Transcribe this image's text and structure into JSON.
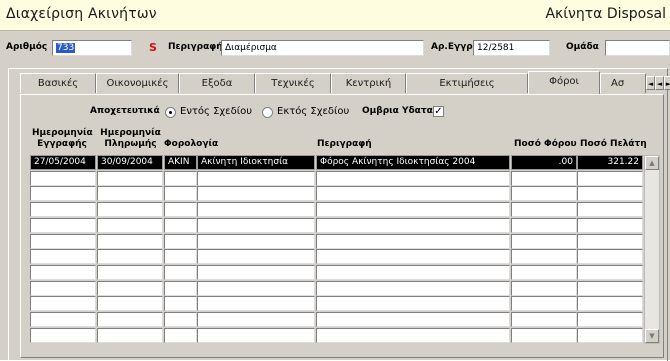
{
  "window": {
    "title": "Διαχείριση Ακινήτων",
    "right_title": "Ακίνητα Disposal"
  },
  "header": {
    "number_label": "Αριθμός",
    "number_value": "733",
    "s_button": "S",
    "description_label": "Περιγραφή",
    "description_value": "Διαμέρισμα",
    "registry_label": "Αρ.Εγγρ",
    "registry_value": "12/2581",
    "group_label": "Ομάδα",
    "group_value": ""
  },
  "tabs": [
    {
      "label": "Βασικές"
    },
    {
      "label": "Οικονομικές"
    },
    {
      "label": "Εξοδα"
    },
    {
      "label": "Τεχνικές"
    },
    {
      "label": "Κεντρική"
    },
    {
      "label": "Εκτιμήσεις"
    },
    {
      "label": "Φόροι",
      "active": true
    },
    {
      "label": "Ασ"
    }
  ],
  "tab_arrows": [
    "◄",
    "◄",
    "►",
    "►"
  ],
  "options": {
    "drainage_label": "Αποχετευτικά",
    "within_plan": "Εντός Σχεδίου",
    "outside_plan": "Εκτός Σχεδίου",
    "selected": "within_plan",
    "rainwater_label": "Ομβρια Υδατα",
    "rainwater_checked": true,
    "check_glyph": "✓"
  },
  "table": {
    "columns": [
      {
        "line1": "Ημερομηνία",
        "line2": "Εγγραφής"
      },
      {
        "line1": "Ημερομηνία",
        "line2": "Πληρωμής"
      },
      {
        "line1": "",
        "line2": "Φορολογία"
      },
      {
        "line1": "",
        "line2": ""
      },
      {
        "line1": "",
        "line2": "Περιγραφή"
      },
      {
        "line1": "",
        "line2": "Ποσό Φόρου"
      },
      {
        "line1": "",
        "line2": "Ποσό Πελάτη"
      }
    ],
    "rows": [
      [
        "27/05/2004",
        "30/09/2004",
        "AKIN",
        "Ακίνητη Ιδιοκτησία",
        "Φόρος Ακίνητης Ιδιοκτησίας 2004",
        ".00",
        "321.22"
      ],
      [
        "",
        "",
        "",
        "",
        "",
        "",
        ""
      ],
      [
        "",
        "",
        "",
        "",
        "",
        "",
        ""
      ],
      [
        "",
        "",
        "",
        "",
        "",
        "",
        ""
      ],
      [
        "",
        "",
        "",
        "",
        "",
        "",
        ""
      ],
      [
        "",
        "",
        "",
        "",
        "",
        "",
        ""
      ],
      [
        "",
        "",
        "",
        "",
        "",
        "",
        ""
      ],
      [
        "",
        "",
        "",
        "",
        "",
        "",
        ""
      ],
      [
        "",
        "",
        "",
        "",
        "",
        "",
        ""
      ],
      [
        "",
        "",
        "",
        "",
        "",
        "",
        ""
      ],
      [
        "",
        "",
        "",
        "",
        "",
        "",
        ""
      ],
      [
        "",
        "",
        "",
        "",
        "",
        "",
        ""
      ]
    ]
  },
  "scrollbar": {
    "up": "▲",
    "down": "▼"
  }
}
